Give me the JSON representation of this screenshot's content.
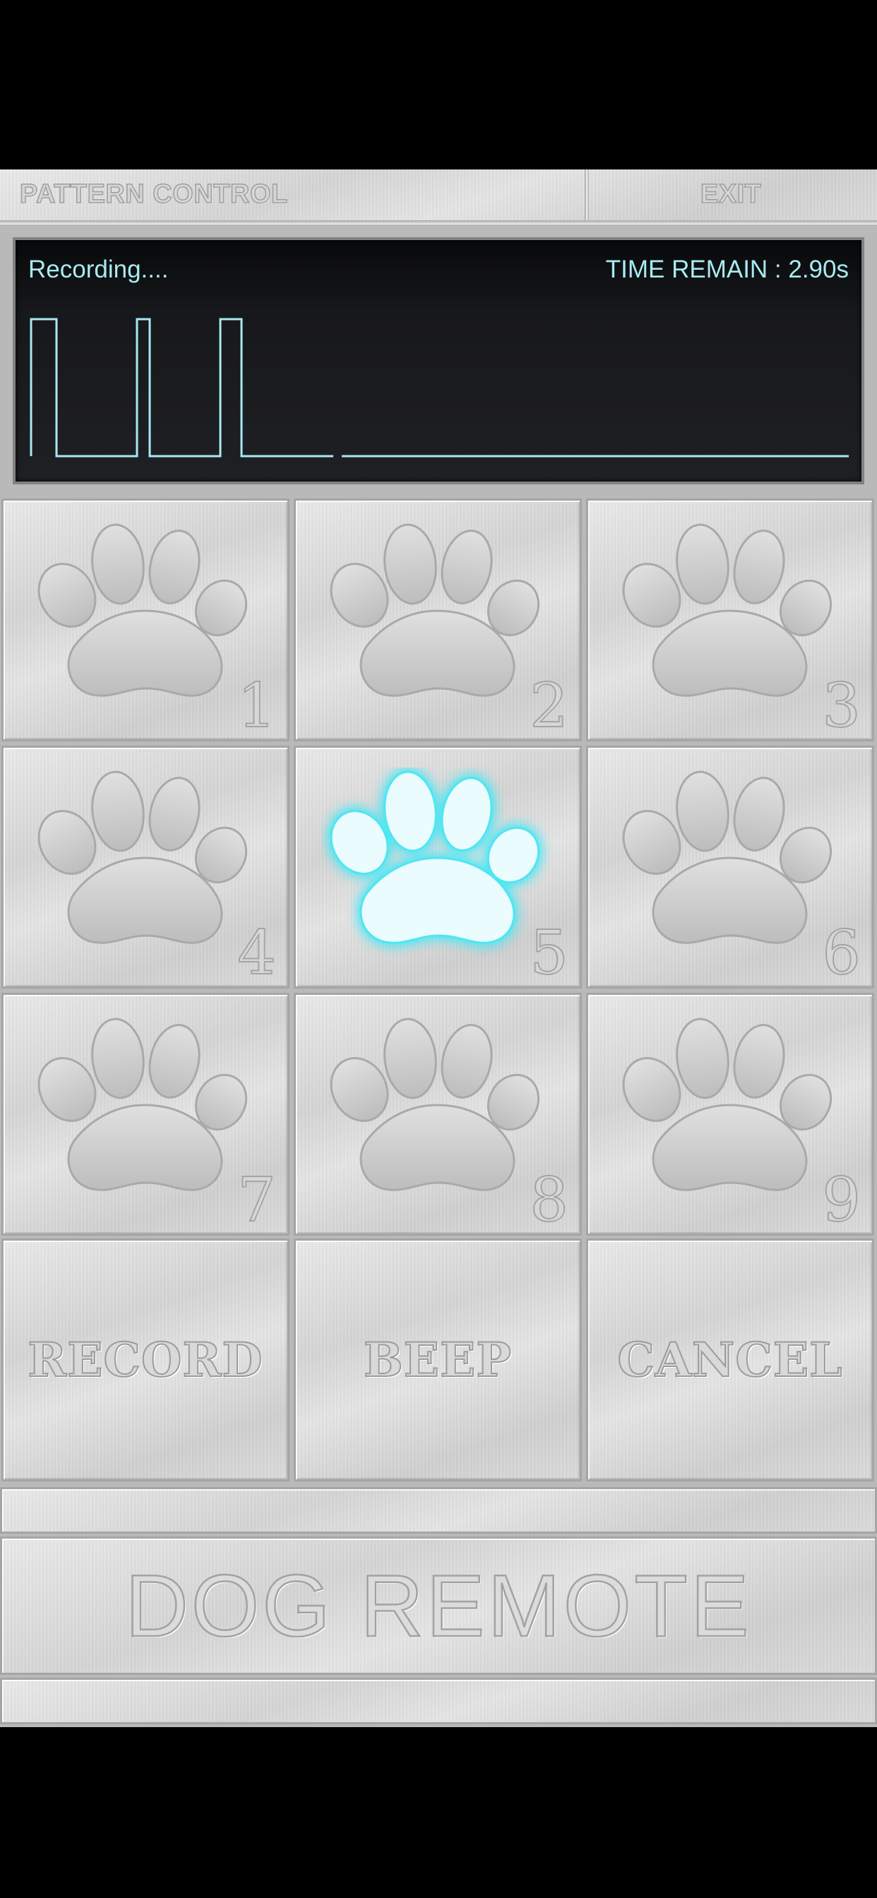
{
  "header": {
    "title": "PATTERN CONTROL",
    "exit_label": "EXIT"
  },
  "display": {
    "status": "Recording....",
    "timer": "TIME REMAIN : 2.90s",
    "waveform_color": "#a8eaf2"
  },
  "keypad": {
    "keys": [
      {
        "number": "1",
        "active": false
      },
      {
        "number": "2",
        "active": false
      },
      {
        "number": "3",
        "active": false
      },
      {
        "number": "4",
        "active": false
      },
      {
        "number": "5",
        "active": true
      },
      {
        "number": "6",
        "active": false
      },
      {
        "number": "7",
        "active": false
      },
      {
        "number": "8",
        "active": false
      },
      {
        "number": "9",
        "active": false
      }
    ],
    "active_color": "#4fe6f2",
    "paw_icon": "paw-icon"
  },
  "actions": {
    "record": "RECORD",
    "beep": "BEEP",
    "cancel": "CANCEL"
  },
  "brand": "DOG REMOTE"
}
